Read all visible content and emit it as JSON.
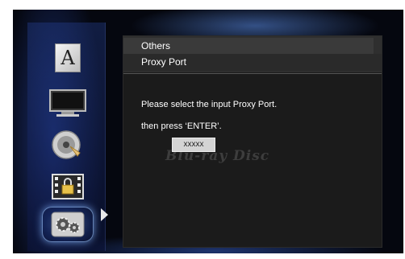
{
  "menu": {
    "items": [
      {
        "name": "language",
        "icon": "letter-a-icon",
        "glyph": "A"
      },
      {
        "name": "display",
        "icon": "tv-monitor-icon"
      },
      {
        "name": "audio",
        "icon": "speaker-disc-icon"
      },
      {
        "name": "parental",
        "icon": "film-lock-icon"
      },
      {
        "name": "others",
        "icon": "gears-icon",
        "selected": true
      }
    ]
  },
  "panel": {
    "category": "Others",
    "title": "Proxy Port",
    "message_line1": "Please select the input Proxy Port.",
    "message_line2": "then press ‘ENTER’.",
    "port_value": "xxxxx",
    "watermark": "Blu-ray Disc"
  },
  "colors": {
    "background": "#05070f",
    "panel": "#1b1b1b",
    "header": "#2f2f2f",
    "text": "#ffffff",
    "input_bg": "#d4d4d4"
  }
}
